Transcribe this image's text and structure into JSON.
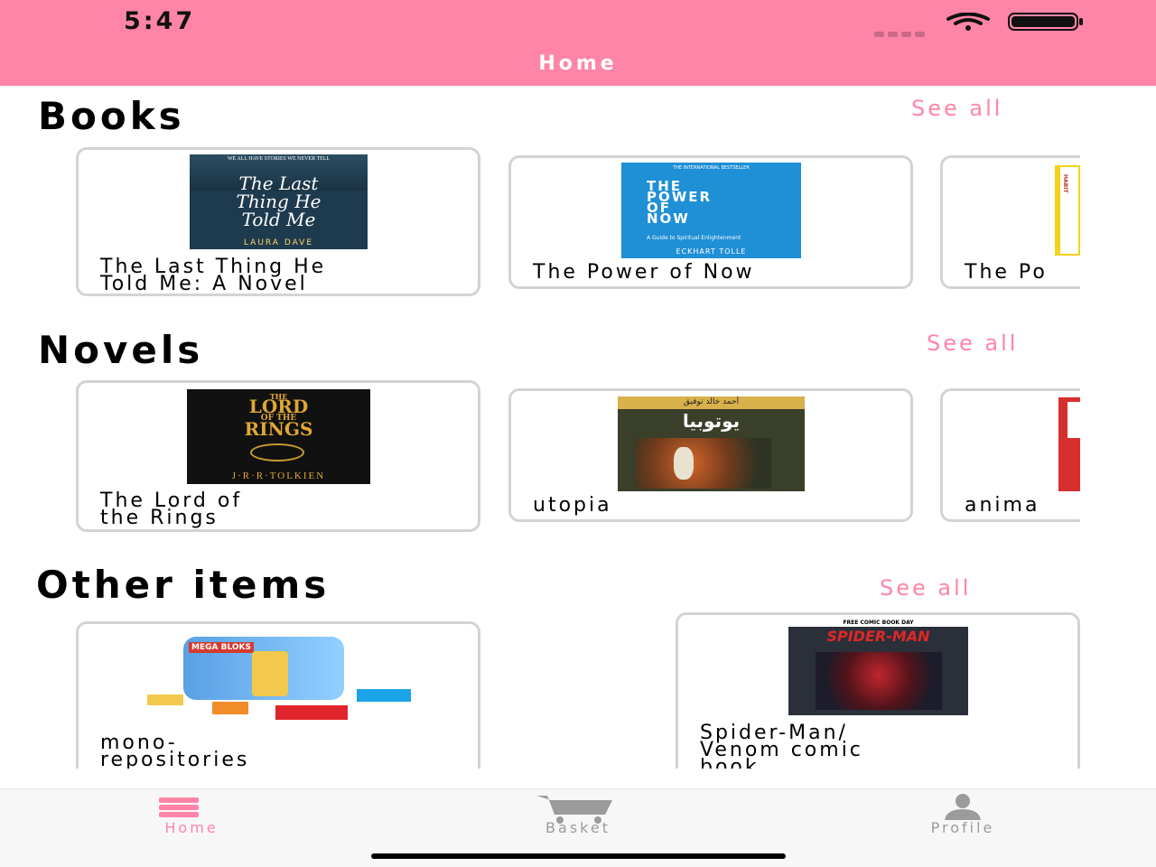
{
  "status": {
    "time": "5:47"
  },
  "nav": {
    "title": "Home"
  },
  "sections": [
    {
      "title": "Books",
      "see_all": "See all",
      "items": [
        {
          "label_lines": [
            "The Last Thing He",
            "Told Me: A Novel"
          ],
          "cover": {
            "line1": "The Last",
            "line2": "Thing He",
            "line3": "Told Me",
            "author": "LAURA DAVE",
            "top": "WE ALL HAVE STORIES WE NEVER TELL"
          }
        },
        {
          "label_lines": [
            "The Power of Now"
          ],
          "cover": {
            "top": "THE INTERNATIONAL BESTSELLER",
            "line1": "THE",
            "line2": "POWER",
            "line3": "OF",
            "line4": "NOW",
            "sub": "A Guide to Spiritual Enlightenment",
            "author": "ECKHART TOLLE"
          }
        },
        {
          "label_lines": [
            "The Po"
          ],
          "cover": {
            "spine": "HABIT"
          }
        }
      ]
    },
    {
      "title": "Novels",
      "see_all": "See all",
      "items": [
        {
          "label_lines": [
            "The Lord of",
            "the Rings"
          ],
          "cover": {
            "line1": "THE",
            "line2": "LORD",
            "line3": "OF THE",
            "line4": "RINGS",
            "author": "J·R·R·TOLKIEN"
          }
        },
        {
          "label_lines": [
            "utopia"
          ],
          "cover": {
            "author": "أحمد خالد توفيق",
            "title": "يوتوبيا"
          }
        },
        {
          "label_lines": [
            "anima"
          ],
          "cover": {}
        }
      ]
    },
    {
      "title": "Other items",
      "see_all": "See all",
      "items": [
        {
          "label_lines": [
            "mono-",
            "repositories"
          ],
          "cover": {
            "brand": "MEGA BLOKS"
          }
        },
        {
          "label_lines": [
            "Spider-Man/",
            "Venom comic",
            "book"
          ],
          "cover": {
            "top": "FREE COMIC BOOK DAY",
            "title": "SPIDER-MAN"
          }
        }
      ]
    }
  ],
  "tabs": [
    {
      "label": "Home",
      "icon": "stack-icon",
      "active": true
    },
    {
      "label": "Basket",
      "icon": "cart-icon",
      "active": false
    },
    {
      "label": "Profile",
      "icon": "person-icon",
      "active": false
    }
  ],
  "colors": {
    "accent": "#ff85a8",
    "inactive": "#9b9b9b",
    "card_border": "#d3d3d3"
  }
}
